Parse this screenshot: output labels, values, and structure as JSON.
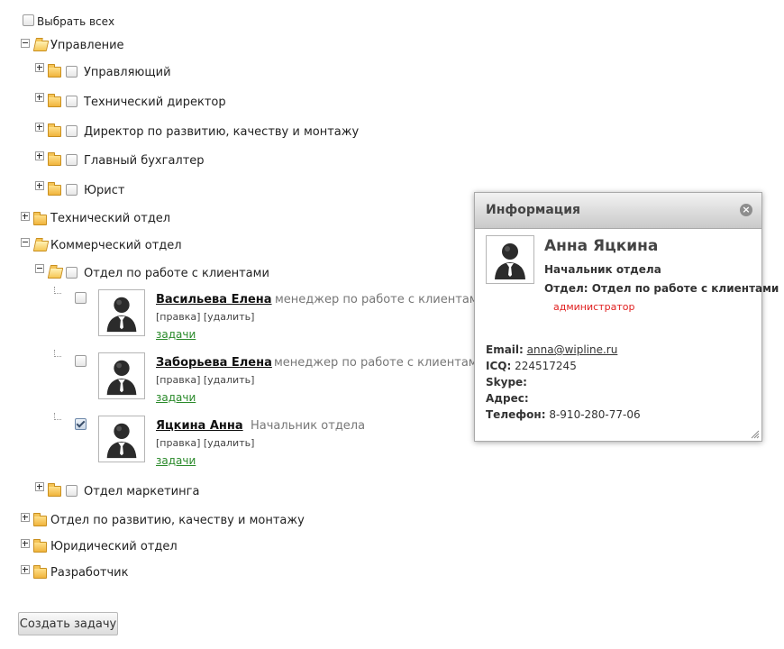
{
  "select_all_label": "Выбрать всех",
  "tree": {
    "management": {
      "label": "Управление",
      "children": [
        "Управляющий",
        "Технический директор",
        "Директор по развитию, качеству и монтажу",
        "Главный бухгалтер",
        "Юрист"
      ]
    },
    "tech_dept": "Технический отдел",
    "commercial": {
      "label": "Коммерческий отдел",
      "client_dept": "Отдел по работе с клиентами",
      "marketing": "Отдел маркетинга"
    },
    "dev_dept": "Отдел по развитию, качеству и монтажу",
    "legal_dept": "Юридический отдел",
    "developer": "Разработчик"
  },
  "employees": [
    {
      "name": "Васильева Елена",
      "role": "менеджер по работе с клиентами",
      "edit": "[правка]",
      "delete": "[удалить]",
      "tasks": "задачи",
      "checked": false
    },
    {
      "name": "Заборьева Елена",
      "role": "менеджер по работе с клиентами",
      "edit": "[правка]",
      "delete": "[удалить]",
      "tasks": "задачи",
      "checked": false
    },
    {
      "name": "Яцкина Анна",
      "role": "Начальник отдела",
      "edit": "[правка]",
      "delete": "[удалить]",
      "tasks": "задачи",
      "checked": true
    }
  ],
  "popup": {
    "title": "Информация",
    "close_icon": "close-icon",
    "name": "Анна Яцкина",
    "position": "Начальник отдела",
    "department": "Отдел: Отдел по работе с клиентами",
    "admin": "администратор",
    "email_label": "Email:",
    "email": "anna@wipline.ru",
    "icq_label": "ICQ:",
    "icq": "224517245",
    "skype_label": "Skype:",
    "address_label": "Адрес:",
    "phone_label": "Телефон:",
    "phone": "8-910-280-77-06"
  },
  "create_task_button": "Создать задачу",
  "colors": {
    "tasks_link": "#2a8a2a",
    "admin": "#e02020"
  }
}
